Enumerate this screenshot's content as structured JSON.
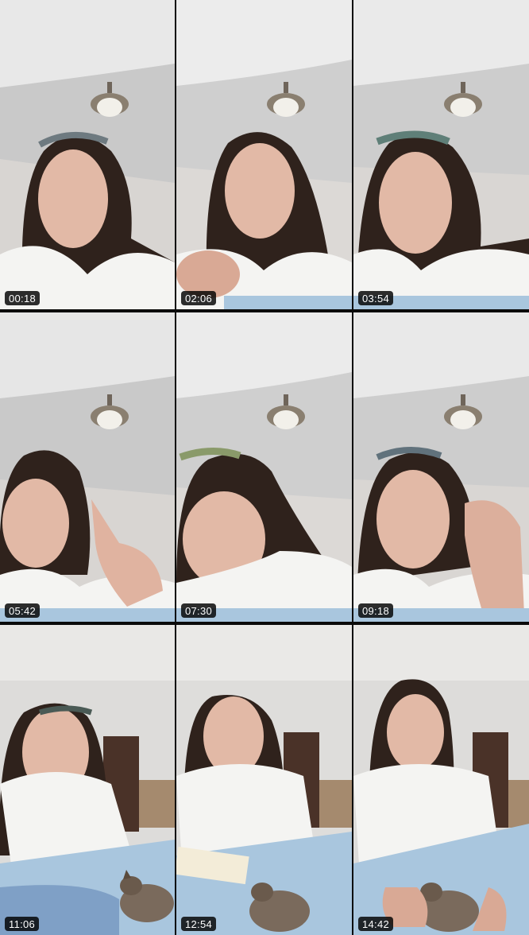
{
  "frames": [
    {
      "timestamp": "00:18",
      "scene": "ceiling"
    },
    {
      "timestamp": "02:06",
      "scene": "ceiling"
    },
    {
      "timestamp": "03:54",
      "scene": "ceiling"
    },
    {
      "timestamp": "05:42",
      "scene": "ceiling"
    },
    {
      "timestamp": "07:30",
      "scene": "ceiling"
    },
    {
      "timestamp": "09:18",
      "scene": "ceiling"
    },
    {
      "timestamp": "11:06",
      "scene": "bedroom"
    },
    {
      "timestamp": "12:54",
      "scene": "bedroom"
    },
    {
      "timestamp": "14:42",
      "scene": "bedroom"
    }
  ],
  "colors": {
    "ceiling": "#d9d9d9",
    "hair": "#2f221c",
    "skin": "#e2b9a6",
    "shirt": "#f4f4f2",
    "blanket": "#a9c6de",
    "timestamp_bg": "#000000"
  }
}
